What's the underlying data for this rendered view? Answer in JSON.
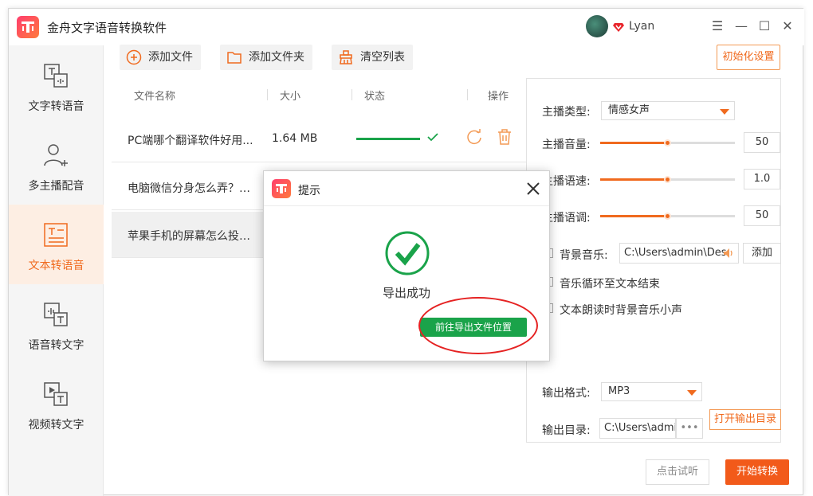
{
  "app": {
    "title": "金舟文字语音转换软件",
    "user_name": "Lyan"
  },
  "window_controls": {
    "menu": "☰",
    "minimize": "—",
    "maximize": "☐",
    "close": "✕"
  },
  "sidebar": {
    "items": [
      {
        "label": "文字转语音",
        "icon": "text-to-speech-icon",
        "active": false
      },
      {
        "label": "多主播配音",
        "icon": "multi-anchor-icon",
        "active": false
      },
      {
        "label": "文本转语音",
        "icon": "document-to-speech-icon",
        "active": true
      },
      {
        "label": "语音转文字",
        "icon": "speech-to-text-icon",
        "active": false
      },
      {
        "label": "视频转文字",
        "icon": "video-to-text-icon",
        "active": false
      }
    ]
  },
  "toolbar": {
    "add_file": "添加文件",
    "add_folder": "添加文件夹",
    "clear_list": "清空列表",
    "reset_settings": "初始化设置"
  },
  "file_list": {
    "headers": {
      "name": "文件名称",
      "size": "大小",
      "status": "状态",
      "actions": "操作"
    },
    "rows": [
      {
        "name": "PC端哪个翻译软件好用...",
        "size": "1.64 MB",
        "progress": 1.0,
        "done": true
      },
      {
        "name": "电脑微信分身怎么弄？微...",
        "size": "",
        "progress": 0,
        "done": false
      },
      {
        "name": "苹果手机的屏幕怎么投屏...",
        "size": "",
        "progress": 0,
        "done": false
      }
    ]
  },
  "settings": {
    "anchor_type_label": "主播类型:",
    "anchor_type_value": "情感女声",
    "volume_label": "主播音量:",
    "volume_value": "50",
    "volume_level": 0.5,
    "speed_label": "主播语速:",
    "speed_value": "1.0",
    "speed_level": 0.5,
    "pitch_label": "主播语调:",
    "pitch_value": "50",
    "pitch_level": 0.5,
    "bgm_label": "背景音乐:",
    "bgm_path": "C:\\Users\\admin\\Des",
    "bgm_add": "添加",
    "loop_label": "音乐循环至文本结束",
    "duck_label": "文本朗读时背景音乐小声",
    "format_label": "输出格式:",
    "format_value": "MP3",
    "dir_label": "输出目录:",
    "dir_path": "C:\\Users\\admir",
    "dir_more": "•••",
    "open_dir": "打开输出目录"
  },
  "bottom": {
    "preview": "点击试听",
    "start": "开始转换"
  },
  "dialog": {
    "title": "提示",
    "message": "导出成功",
    "goto_button": "前往导出文件位置"
  },
  "colors": {
    "accent": "#f06a1e",
    "success": "#1aa34a",
    "highlight": "#e52222"
  }
}
